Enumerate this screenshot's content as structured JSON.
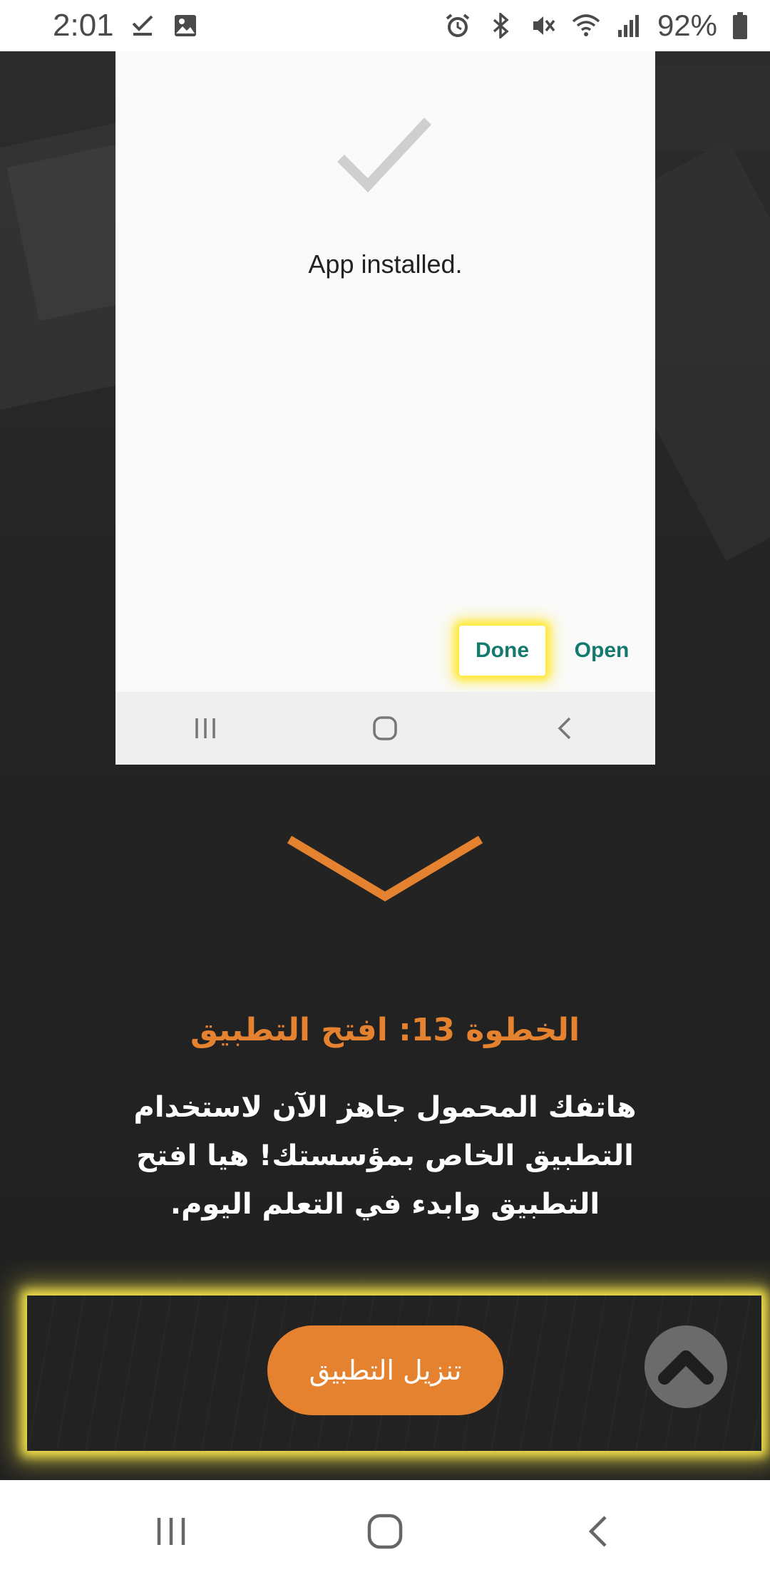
{
  "status_bar": {
    "time": "2:01",
    "battery_percent": "92%",
    "left_icons": [
      "checkmark-icon",
      "image-icon"
    ],
    "right_icons": [
      "alarm-icon",
      "bluetooth-icon",
      "mute-icon",
      "wifi-icon",
      "signal-icon",
      "battery-icon"
    ]
  },
  "install_dialog": {
    "icon": "checkmark-icon",
    "message": "App installed.",
    "done_label": "Done",
    "open_label": "Open",
    "nav_icons": [
      "recents-icon",
      "home-icon",
      "back-icon"
    ]
  },
  "step": {
    "title": "الخطوة 13: افتح التطبيق",
    "body": "هاتفك المحمول جاهز الآن لاستخدام التطبيق الخاص بمؤسستك! هيا افتح التطبيق وابدء في التعلم اليوم."
  },
  "bottom_bar": {
    "download_label": "تنزيل التطبيق",
    "scroll_top_icon": "chevron-up-icon"
  },
  "system_nav": {
    "icons": [
      "recents-icon",
      "home-icon",
      "back-icon"
    ]
  },
  "colors": {
    "accent_orange": "#e5822f",
    "teal_text": "#147a6d",
    "highlight_yellow": "#f1e04a",
    "page_bg": "#232323"
  }
}
